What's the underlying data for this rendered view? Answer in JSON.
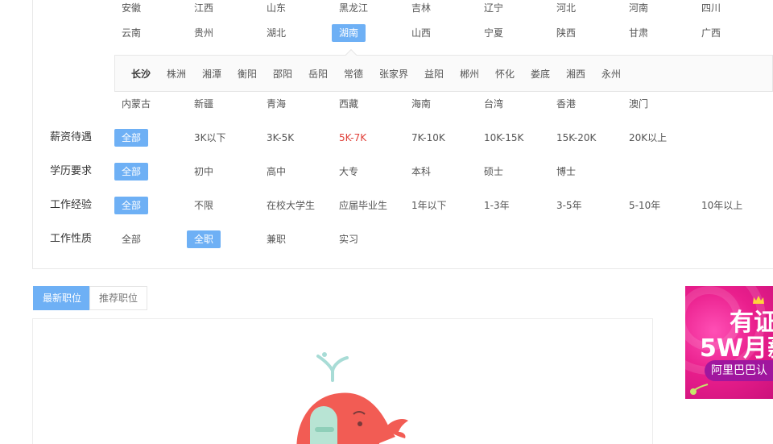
{
  "provinces_row1": [
    "安徽",
    "江西",
    "山东",
    "黑龙江",
    "吉林",
    "辽宁",
    "河北",
    "河南",
    "四川"
  ],
  "provinces_row2": [
    "云南",
    "贵州",
    "湖北",
    "湖南",
    "山西",
    "宁夏",
    "陕西",
    "甘肃",
    "广西"
  ],
  "selected_province": "湖南",
  "subcities": [
    "长沙",
    "株洲",
    "湘潭",
    "衡阳",
    "邵阳",
    "岳阳",
    "常德",
    "张家界",
    "益阳",
    "郴州",
    "怀化",
    "娄底",
    "湘西",
    "永州"
  ],
  "provinces_row3": [
    "内蒙古",
    "新疆",
    "青海",
    "西藏",
    "海南",
    "台湾",
    "香港",
    "澳门"
  ],
  "salary": {
    "label": "薪资待遇",
    "options": [
      "全部",
      "3K以下",
      "3K-5K",
      "5K-7K",
      "7K-10K",
      "10K-15K",
      "15K-20K",
      "20K以上"
    ]
  },
  "education": {
    "label": "学历要求",
    "options": [
      "全部",
      "初中",
      "高中",
      "大专",
      "本科",
      "硕士",
      "博士"
    ]
  },
  "experience": {
    "label": "工作经验",
    "options": [
      "全部",
      "不限",
      "在校大学生",
      "应届毕业生",
      "1年以下",
      "1-3年",
      "3-5年",
      "5-10年",
      "10年以上"
    ]
  },
  "jobtype": {
    "label": "工作性质",
    "options": [
      "全部",
      "全职",
      "兼职",
      "实习"
    ]
  },
  "tabs": [
    "最新职位",
    "推荐职位"
  ],
  "ad": {
    "line1": "有证",
    "line2": "5W月薪",
    "line3": "阿里巴巴认"
  },
  "colors": {
    "accent": "#6eb0f5",
    "highlight_red": "#e0413a",
    "ad_magenta": "#e91e8c",
    "whale": "#f25c54"
  },
  "icons": [
    "whale-illustration-icon",
    "crown-icon",
    "pea-icon"
  ]
}
